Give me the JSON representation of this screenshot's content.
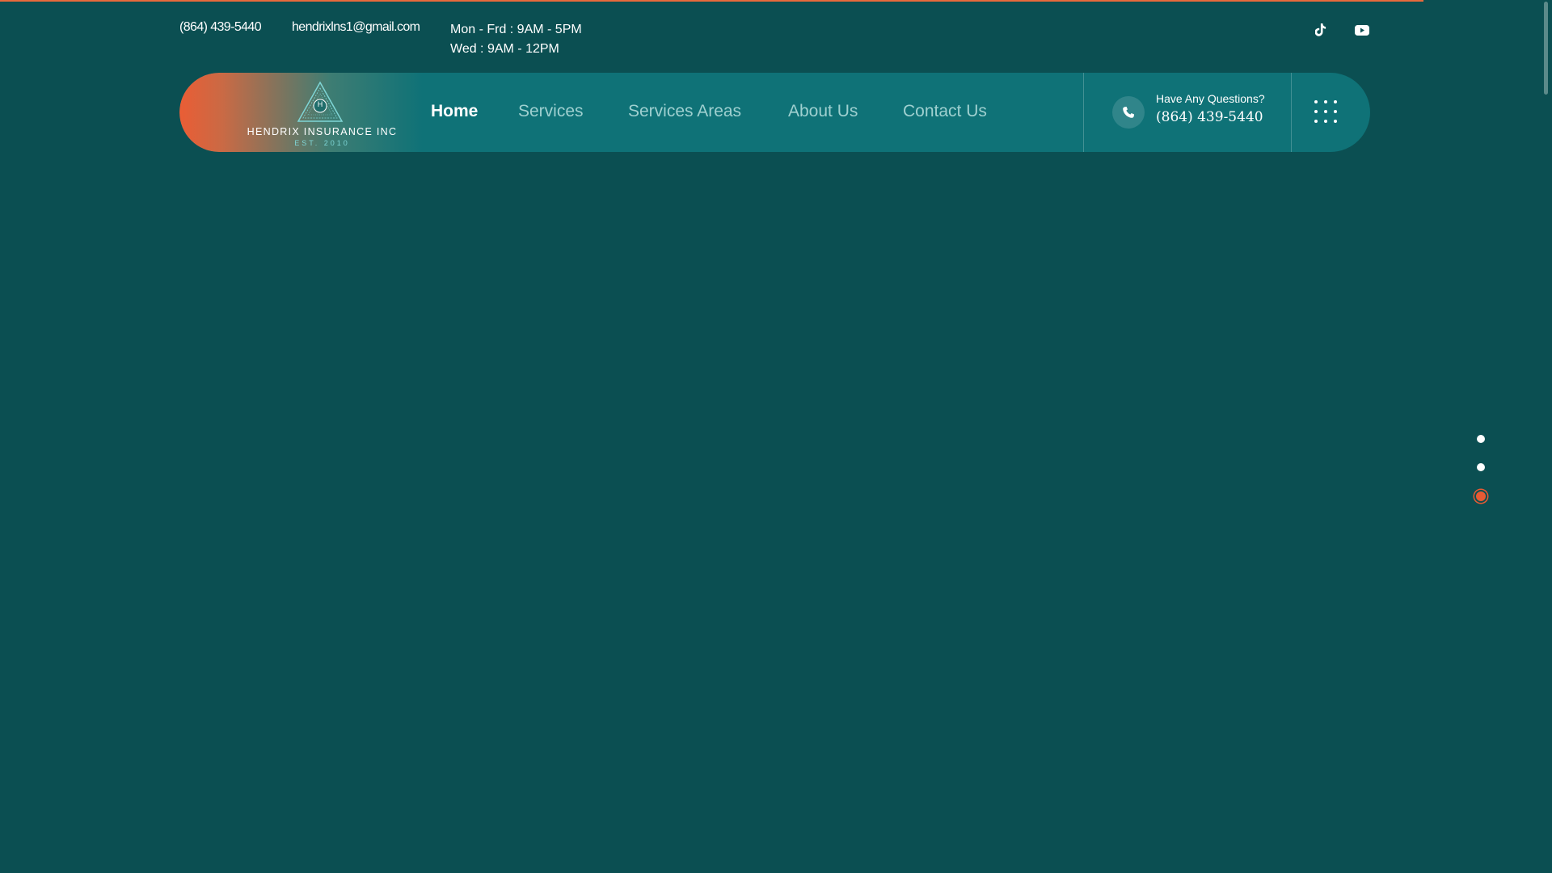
{
  "topbar": {
    "phone": "(864) 439-5440",
    "email": "hendrixlns1@gmail.com",
    "hours_line1": "Mon - Frd : 9AM - 5PM",
    "hours_line2": "Wed : 9AM - 12PM",
    "social": [
      "tiktok-icon",
      "youtube-icon"
    ]
  },
  "logo": {
    "name": "HENDRIX INSURANCE INC",
    "est": "EST. 2010",
    "monogram": "H"
  },
  "nav": {
    "items": [
      {
        "label": "Home",
        "active": true
      },
      {
        "label": "Services",
        "active": false
      },
      {
        "label": "Services Areas",
        "active": false
      },
      {
        "label": "About Us",
        "active": false
      },
      {
        "label": "Contact Us",
        "active": false
      }
    ]
  },
  "contact": {
    "question": "Have Any Questions?",
    "phone": "(864) 439-5440"
  },
  "slider": {
    "count": 3,
    "active_index": 3
  },
  "colors": {
    "background": "#0b4f52",
    "navbar": "#0f7277",
    "accent": "#e85a33",
    "text": "#ffffff",
    "nav_inactive": "#9fd0d0"
  }
}
